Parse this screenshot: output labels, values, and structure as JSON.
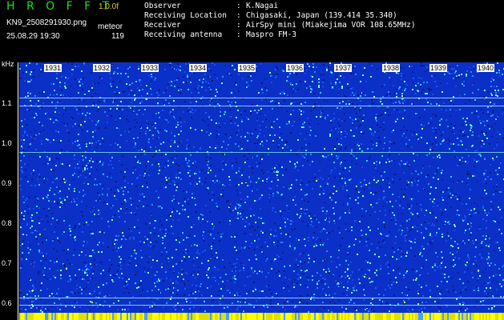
{
  "header": {
    "app_title": "H R O F F T",
    "version": "1.0.0f",
    "filename": "KN9_2508291930.png",
    "meteor_label": "meteor",
    "timestamp": "25.08.29 19:30",
    "meteor_count": "119"
  },
  "info": [
    {
      "key": "Observer",
      "value": "K.Nagai"
    },
    {
      "key": "Receiving Location",
      "value": "Chigasaki, Japan (139.414 35.340)"
    },
    {
      "key": "Receiver",
      "value": "AirSpy mini (Miakejima VOR 108.65MHz)"
    },
    {
      "key": "Receiving antenna",
      "value": "Maspro FM-3"
    }
  ],
  "info_separator": ":",
  "axis": {
    "unit": "kHz",
    "y_labels": [
      "1.1",
      "1.0",
      "0.9",
      "0.8",
      "0.7",
      "0.6"
    ],
    "minute_labels": [
      "1931",
      "1932",
      "1933",
      "1934",
      "1935",
      "1936",
      "1937",
      "1938",
      "1939",
      "1940"
    ]
  },
  "colors": {
    "background": "#0a30c8",
    "title": "#1ee01e",
    "version": "#d9d32a",
    "info_value": "#ffffff",
    "bottom_strip": "#ffff00"
  }
}
